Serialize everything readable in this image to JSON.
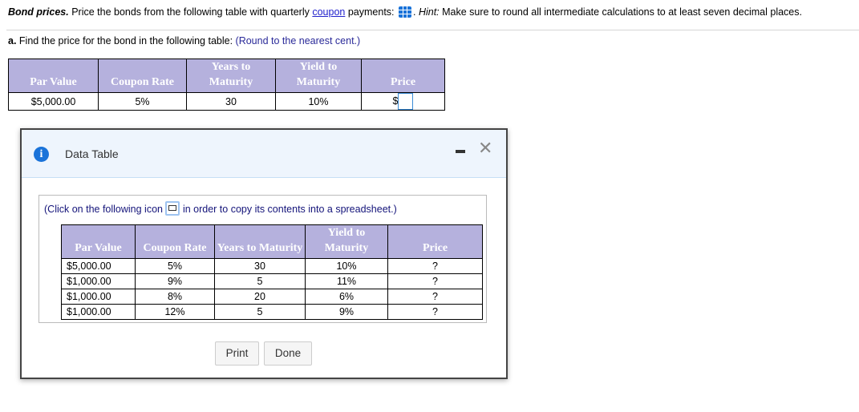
{
  "question": {
    "title": "Bond prices.",
    "text_before": " Price the bonds from the following table with quarterly ",
    "link": "coupon",
    "text_after": " payments: ",
    "hint_label": "Hint:",
    "hint_text": " Make sure to round all intermediate calculations to at least seven decimal places.",
    "hint_prefix": ". "
  },
  "part_a": {
    "label": "a.",
    "text": " Find the price for the bond in the following table: ",
    "hint": "(Round to the nearest cent.)",
    "headers": [
      "Par Value",
      "Coupon Rate",
      "Years to Maturity",
      "Yield to Maturity",
      "Price"
    ],
    "row": {
      "par": "$5,000.00",
      "coupon": "5%",
      "years": "30",
      "ytm": "10%",
      "price_prefix": "$",
      "price_value": ""
    }
  },
  "dialog": {
    "title": "Data Table",
    "note_before": "(Click on the following icon ",
    "note_after": " in order to copy its contents into a spreadsheet.)",
    "headers": [
      "Par Value",
      "Coupon Rate",
      "Years to Maturity",
      "Yield to Maturity",
      "Price"
    ],
    "rows": [
      [
        "$5,000.00",
        "5%",
        "30",
        "10%",
        "?"
      ],
      [
        "$1,000.00",
        "9%",
        "5",
        "11%",
        "?"
      ],
      [
        "$1,000.00",
        "8%",
        "20",
        "6%",
        "?"
      ],
      [
        "$1,000.00",
        "12%",
        "5",
        "9%",
        "?"
      ]
    ],
    "print": "Print",
    "done": "Done"
  }
}
